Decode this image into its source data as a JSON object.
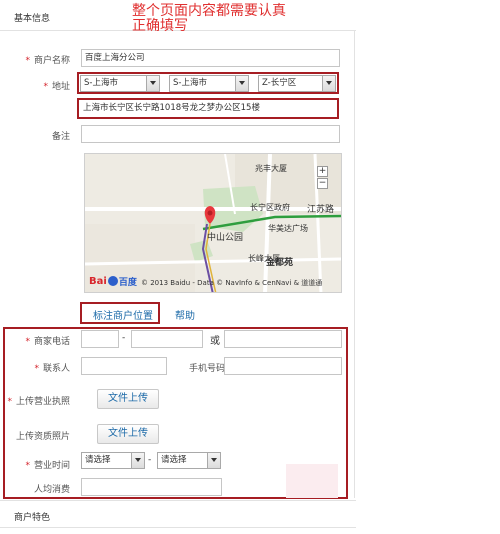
{
  "annotation": {
    "line1": "整个页面内容都需要认真",
    "line2": "正确填写"
  },
  "sections": {
    "basic_info": "基本信息",
    "features": "商户特色"
  },
  "form": {
    "merchant_name": {
      "label": "商户名称",
      "value": "百度上海分公司"
    },
    "address": {
      "label": "地址",
      "province": "S-上海市",
      "city": "S-上海市",
      "district": "Z-长宁区",
      "detail": "上海市长宁区长宁路1018号龙之梦办公区15楼"
    },
    "remark": {
      "label": "备注",
      "value": ""
    },
    "phone": {
      "label": "商家电话",
      "dash": "-",
      "or": "或"
    },
    "contact": {
      "label": "联系人",
      "mobile_label": "手机号码"
    },
    "license": {
      "label": "上传营业执照",
      "button": "文件上传"
    },
    "qualification": {
      "label": "上传资质照片",
      "button": "文件上传"
    },
    "hours": {
      "label": "营业时间",
      "start": "请选择",
      "dash": "-",
      "end": "请选择"
    },
    "avg_price": {
      "label": "人均消费"
    }
  },
  "map": {
    "labels": {
      "zhaofeng": "兆丰大厦",
      "changning_gov": "长宁区政府",
      "jiangsu_rd": "江苏路",
      "zhongshan_park": "中山公园",
      "huamei": "华美达广场",
      "changfeng": "长峰大厦",
      "jindu": "金都苑"
    },
    "zoom_in": "+",
    "zoom_out": "−",
    "logo_text": "Bai",
    "logo_text2": "百度",
    "copyright": "© 2013 Baidu - Data © NavInfo & CenNavi & 道道通",
    "accent_road": "#2e9e3e",
    "accent_rail": "#6b4fa3",
    "marker_color": "#e8383d"
  },
  "actions": {
    "mark_location": "标注商户位置",
    "help": "帮助"
  }
}
